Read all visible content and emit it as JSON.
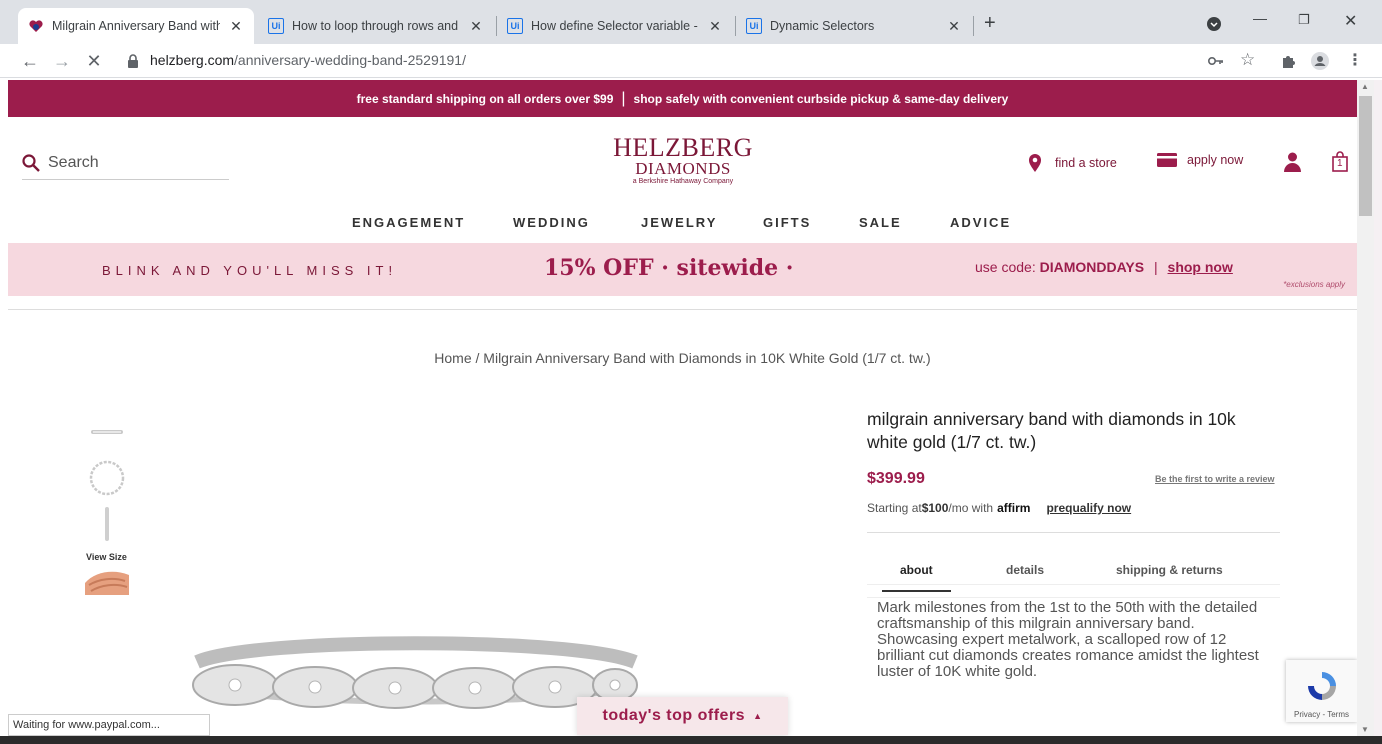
{
  "browser": {
    "tabs": [
      {
        "title": "Milgrain Anniversary Band with D",
        "active": true,
        "favicon": "helzberg-heart-icon"
      },
      {
        "title": "How to loop through rows and c",
        "active": false,
        "favicon": "uipath-icon"
      },
      {
        "title": "How define Selector variable - He",
        "active": false,
        "favicon": "uipath-icon"
      },
      {
        "title": "Dynamic Selectors",
        "active": false,
        "favicon": "uipath-icon"
      }
    ],
    "favicon_text": "Ui",
    "new_tab": "+",
    "url_host": "helzberg.com",
    "url_path": "/anniversary-wedding-band-2529191/",
    "status": "Waiting for www.paypal.com..."
  },
  "site": {
    "promo": {
      "left": "free standard shipping on all orders over $99",
      "sep": "|",
      "right": "shop safely with convenient curbside pickup & same-day delivery"
    },
    "search_label": "Search",
    "logo": {
      "line1": "HELZBERG",
      "line2": "DIAMONDS",
      "line3": "a Berkshire Hathaway Company"
    },
    "find_store": "find a store",
    "apply_now": "apply now",
    "cart_count": "1",
    "nav": [
      "ENGAGEMENT",
      "WEDDING",
      "JEWELRY",
      "GIFTS",
      "SALE",
      "ADVICE"
    ],
    "sale_banner": {
      "blink": "BLINK AND YOU'LL MISS IT!",
      "offer": "15% OFF · sitewide ·",
      "use_code": "use code:",
      "code": "DIAMONDDAYS",
      "sep": "|",
      "shop_now": "shop now",
      "exclusions": "*exclusions apply"
    },
    "breadcrumb": {
      "home": "Home",
      "sep": " / ",
      "current": "Milgrain Anniversary Band with Diamonds in 10K White Gold (1/7 ct. tw.)"
    },
    "thumbnails_label": "View Size",
    "product": {
      "title": "milgrain anniversary band with diamonds in 10k white gold (1/7 ct. tw.)",
      "price": "$399.99",
      "review_link": "Be the first to write a review",
      "financing_prefix": "Starting at ",
      "financing_amount": "$100",
      "financing_suffix": "/mo with ",
      "affirm": "affirm",
      "prequalify": "prequalify now",
      "tabs": [
        "about",
        "details",
        "shipping & returns"
      ],
      "description": "Mark milestones from the 1st to the 50th with the detailed craftsmanship of this milgrain anniversary band. Showcasing expert metalwork, a scalloped row of 12 brilliant cut diamonds creates romance amidst the lightest luster of 10K white gold."
    },
    "offers_button": "today's top offers",
    "recaptcha_links": "Privacy - Terms"
  },
  "colors": {
    "brand": "#9c1d4c",
    "banner_pink": "#f6d8df",
    "logo": "#7b1737"
  }
}
